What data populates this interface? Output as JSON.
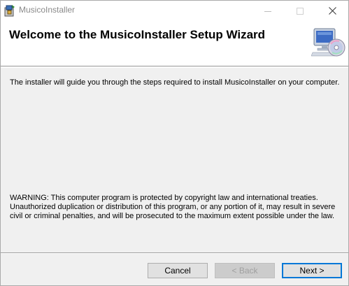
{
  "window": {
    "title": "MusicoInstaller"
  },
  "banner": {
    "title": "Welcome to the MusicoInstaller Setup Wizard",
    "graphic_icon": "computer-cd-icon"
  },
  "body": {
    "intro": "The installer will guide you through the steps required to install MusicoInstaller on your computer.",
    "warning": "WARNING: This computer program is protected by copyright law and international treaties. Unauthorized duplication or distribution of this program, or any portion of it, may result in severe civil or criminal penalties, and will be prosecuted to the maximum extent possible under the law."
  },
  "buttons": {
    "cancel": "Cancel",
    "back": "< Back",
    "next": "Next >"
  },
  "colors": {
    "accent": "#0078d7",
    "dialog_bg": "#f0f0f0",
    "disabled_text": "#a0a0a0"
  }
}
